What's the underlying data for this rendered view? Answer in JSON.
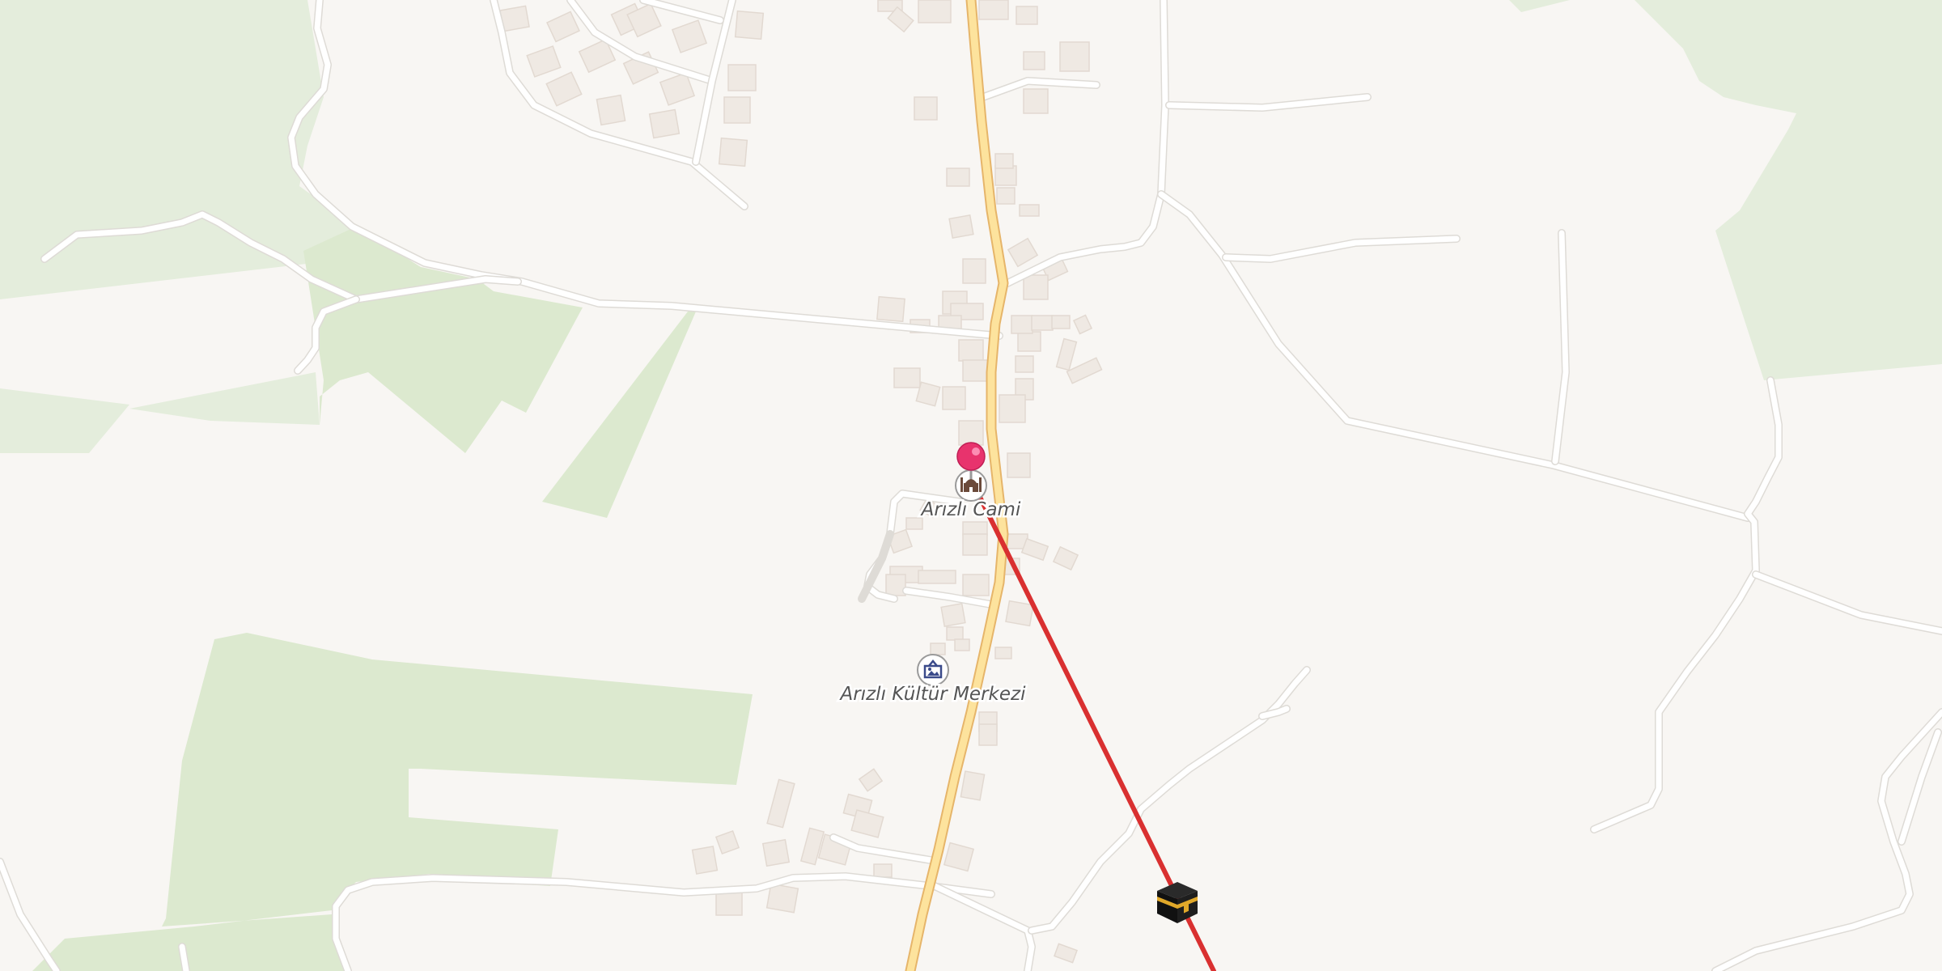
{
  "map": {
    "pois": [
      {
        "id": "mosque",
        "name": "Arızlı Cami",
        "icon": "mosque-icon"
      },
      {
        "id": "culture",
        "name": "Arızlı Kültür Merkezi",
        "icon": "museum-icon"
      }
    ],
    "markers": {
      "pin": {
        "icon": "map-pin-icon",
        "color": "#e8336d"
      },
      "kaaba": {
        "icon": "kaaba-icon"
      }
    },
    "qibla_line": {
      "color": "#d93030"
    }
  }
}
